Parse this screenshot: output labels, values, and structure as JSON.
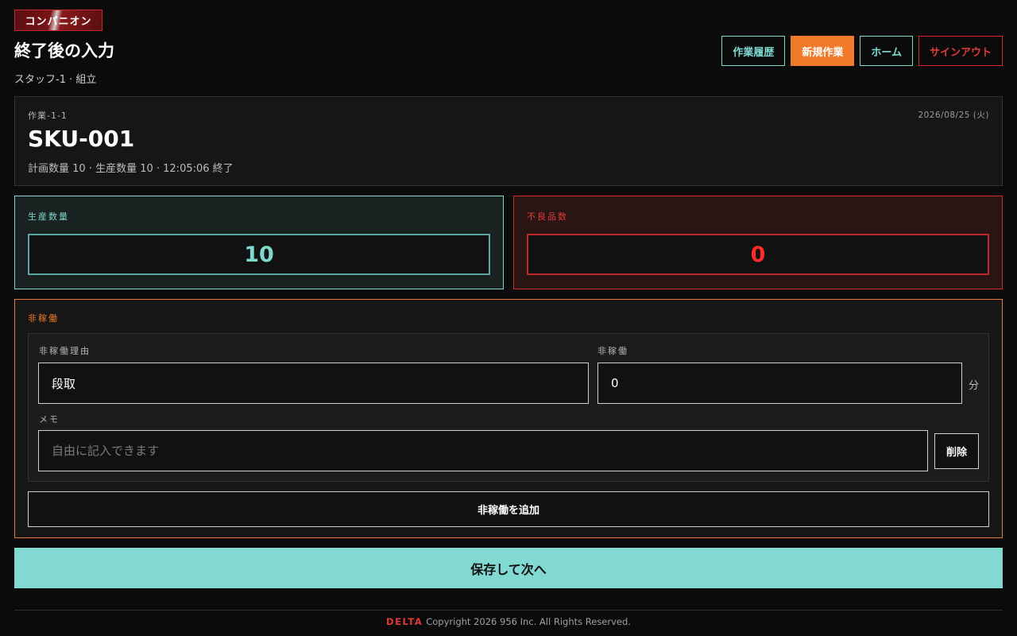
{
  "brand": {
    "badge": "コンパニオン",
    "accent": "#d52a2a"
  },
  "header": {
    "title": "終了後の入力",
    "subtitle": "スタッフ-1 · 組立"
  },
  "nav": {
    "history": "作業履歴",
    "new_job": "新規作業",
    "home": "ホーム",
    "sign_out": "サインアウト"
  },
  "job": {
    "id": "作業-1-1",
    "date": "2026/08/25 (火)",
    "sku": "SKU-001",
    "meta": "計画数量 10 · 生産数量 10 · 12:05:06 終了"
  },
  "production": {
    "label": "生産数量",
    "value": "10"
  },
  "defects": {
    "label": "不良品数",
    "value": "0"
  },
  "downtime": {
    "title": "非稼働",
    "entry": {
      "reason_label": "非稼働理由",
      "reason_value": "段取",
      "minutes_label": "非稼働",
      "minutes_value": "0",
      "minutes_unit": "分",
      "memo_label": "メモ",
      "memo_placeholder": "自由に記入できます",
      "delete_label": "削除"
    },
    "add_label": "非稼働を追加"
  },
  "actions": {
    "save_next": "保存して次へ"
  },
  "footer": {
    "brand": "DELTA",
    "copyright": "Copyright 2026 956 Inc. All Rights Reserved."
  },
  "colors": {
    "teal": "#7fd8d0",
    "orange": "#f07a2a",
    "red": "#e23a3a",
    "background": "#0b0b0b"
  }
}
